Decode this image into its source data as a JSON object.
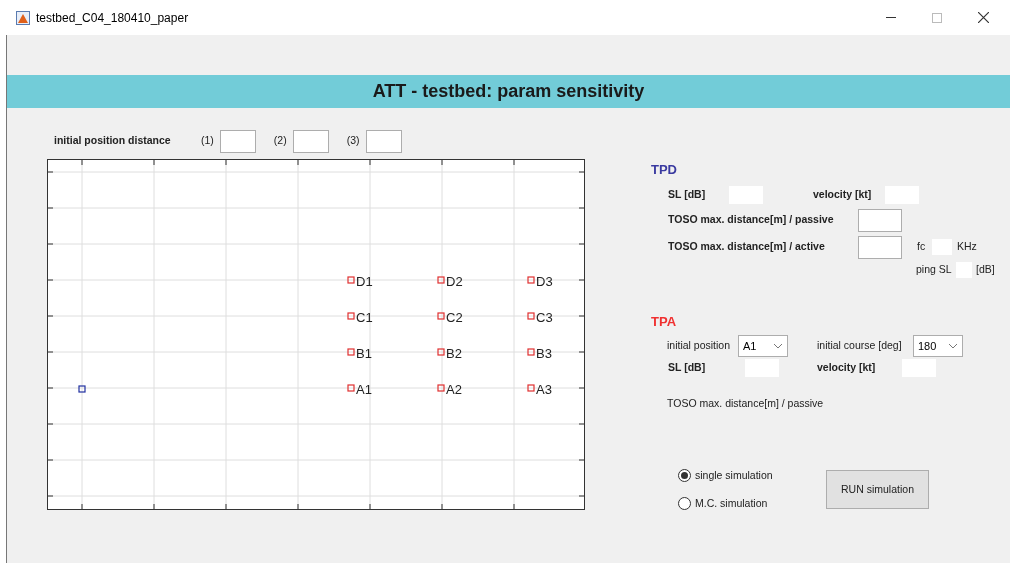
{
  "window": {
    "title": "testbed_C04_180410_paper"
  },
  "header": {
    "title": "ATT - testbed: param sensitivity"
  },
  "initial_position_distance": {
    "label": "initial position distance",
    "fields": [
      {
        "label": "(1)"
      },
      {
        "label": "(2)"
      },
      {
        "label": "(3)"
      }
    ]
  },
  "plot": {
    "target_rows": [
      [
        "D1",
        "D2",
        "D3"
      ],
      [
        "C1",
        "C2",
        "C3"
      ],
      [
        "B1",
        "B2",
        "B3"
      ],
      [
        "A1",
        "A2",
        "A3"
      ]
    ]
  },
  "tpd": {
    "title": "TPD",
    "sl_label": "SL [dB]",
    "velocity_label": "velocity [kt]",
    "toso_passive_label": "TOSO max. distance[m] / passive",
    "toso_active_label": "TOSO max. distance[m] / active",
    "fc_label": "fc",
    "fc_unit": "KHz",
    "ping_sl_label": "ping SL",
    "ping_sl_unit": "[dB]"
  },
  "tpa": {
    "title": "TPA",
    "initial_position": {
      "label": "initial position",
      "value": "A1"
    },
    "initial_course": {
      "label": "initial course [deg]",
      "value": "180"
    },
    "sl_label": "SL [dB]",
    "velocity_label": "velocity [kt]",
    "toso_passive_label": "TOSO max. distance[m] / passive"
  },
  "simulation_mode": [
    {
      "label": "single simulation",
      "selected": true
    },
    {
      "label": "M.C. simulation",
      "selected": false
    }
  ],
  "run_button": "RUN simulation"
}
